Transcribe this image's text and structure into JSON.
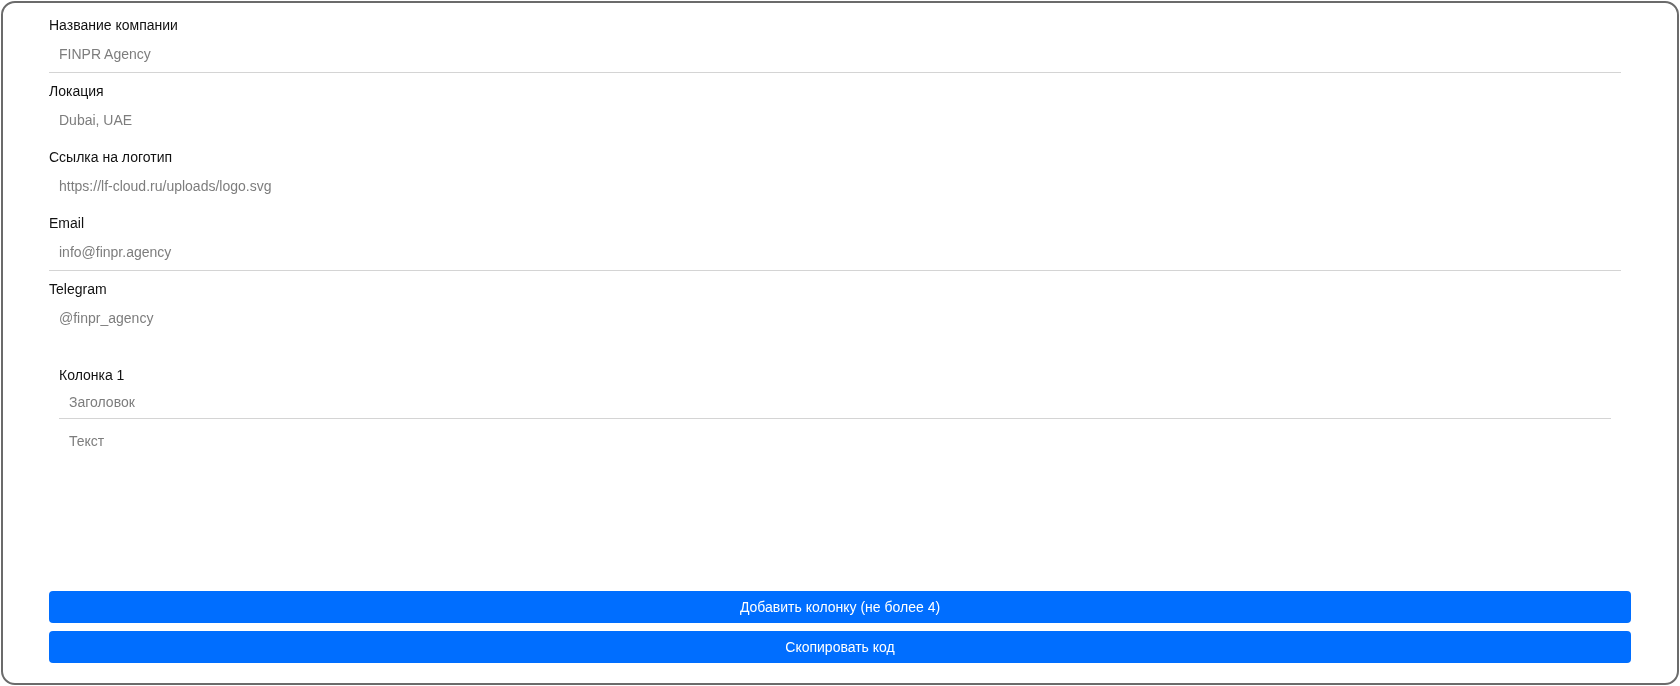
{
  "fields": [
    {
      "label": "Название компании",
      "placeholder": "FINPR Agency",
      "underlined": true
    },
    {
      "label": "Локация",
      "placeholder": "Dubai, UAE",
      "underlined": false
    },
    {
      "label": "Ссылка на логотип",
      "placeholder": "https://lf-cloud.ru/uploads/logo.svg",
      "underlined": false
    },
    {
      "label": "Email",
      "placeholder": "info@finpr.agency",
      "underlined": true
    },
    {
      "label": "Telegram",
      "placeholder": "@finpr_agency",
      "underlined": false
    }
  ],
  "columns": [
    {
      "label": "Колонка 1",
      "title_placeholder": "Заголовок",
      "text_placeholder": "Текст"
    }
  ],
  "buttons": [
    "Добавить колонку (не более 4)",
    "Скопировать код"
  ]
}
